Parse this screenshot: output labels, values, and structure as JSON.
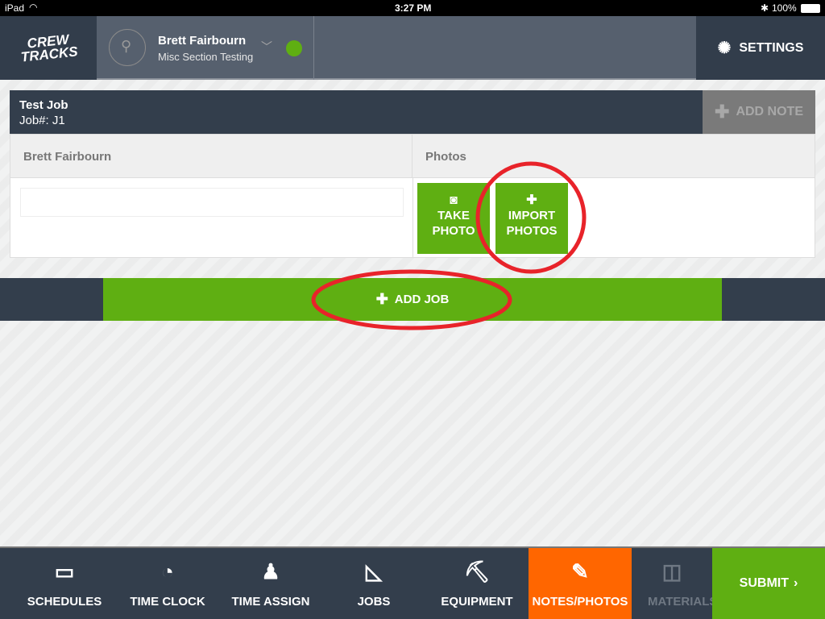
{
  "status": {
    "device": "iPad",
    "time": "3:27 PM",
    "battery": "100%"
  },
  "header": {
    "logo": "CREW TRACKS",
    "user_name": "Brett Fairbourn",
    "user_subtitle": "Misc Section Testing",
    "status_color": "#5faf12",
    "settings": "SETTINGS"
  },
  "job": {
    "title": "Test Job",
    "number": "Job#: J1",
    "add_note": "ADD NOTE"
  },
  "table": {
    "col1": "Brett Fairbourn",
    "col2": "Photos",
    "note_value": "",
    "take_photo": [
      "TAKE",
      "PHOTO"
    ],
    "import_photos": [
      "IMPORT",
      "PHOTOS"
    ]
  },
  "add_job": "ADD JOB",
  "nav": {
    "items": [
      {
        "label": "SCHEDULES",
        "icon": "calendar-icon"
      },
      {
        "label": "TIME CLOCK",
        "icon": "clock-icon"
      },
      {
        "label": "TIME ASSIGN",
        "icon": "person-icon"
      },
      {
        "label": "JOBS",
        "icon": "triangle-ruler-icon"
      },
      {
        "label": "EQUIPMENT",
        "icon": "pickaxe-icon"
      },
      {
        "label": "NOTES/PHOTOS",
        "icon": "notes-icon",
        "active": true
      },
      {
        "label": "MATERIALS",
        "icon": "materials-icon"
      }
    ],
    "submit": "SUBMIT"
  },
  "colors": {
    "green": "#5faf12",
    "orange": "#ff6600",
    "dark": "#333e4c",
    "annotation": "#e8232a"
  }
}
